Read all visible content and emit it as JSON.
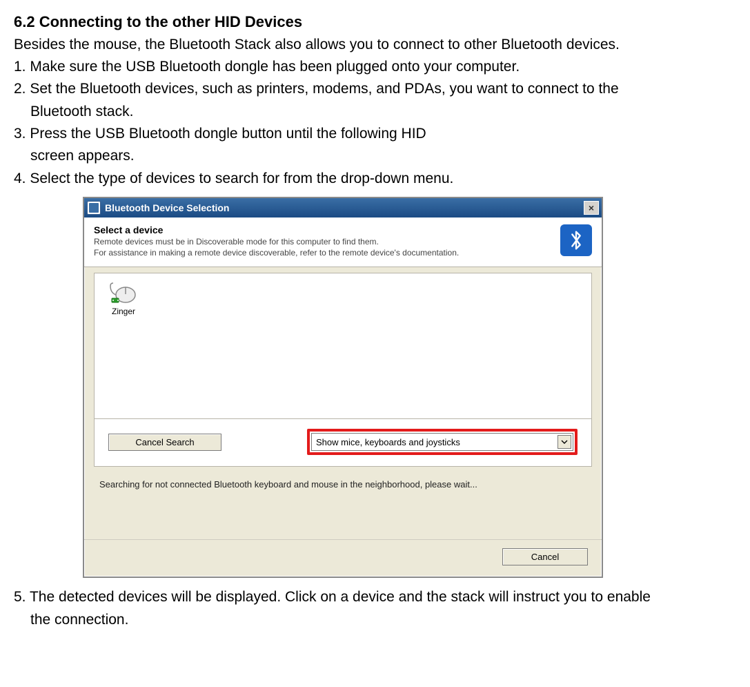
{
  "doc": {
    "heading": "6.2 Connecting to the other HID Devices",
    "intro": "Besides the mouse, the Bluetooth Stack also allows you to connect to other Bluetooth devices.",
    "step1": "1. Make sure the USB Bluetooth dongle has been plugged onto your computer.",
    "step2": "2. Set the Bluetooth devices, such as printers, modems, and PDAs, you want to connect to the",
    "step2b": "Bluetooth stack.",
    "step3": "3. Press the USB Bluetooth dongle button until the following HID",
    "step3b": "screen appears.",
    "step4": "4. Select the type of devices to search for from the drop-down menu.",
    "step5": "5. The detected devices will be displayed. Click on a device and the stack will instruct you to enable",
    "step5b": "the connection."
  },
  "dialog": {
    "title": "Bluetooth Device Selection",
    "banner_heading": "Select a device",
    "banner_line1": "Remote devices must be in Discoverable mode for this computer to find them.",
    "banner_line2": "For assistance in making a remote device discoverable, refer to the remote device's documentation.",
    "device_label": "Zinger",
    "cancel_search": "Cancel Search",
    "dropdown_value": "Show mice, keyboards and joysticks",
    "status": "Searching for not connected Bluetooth keyboard and mouse in the neighborhood, please wait...",
    "cancel": "Cancel"
  }
}
